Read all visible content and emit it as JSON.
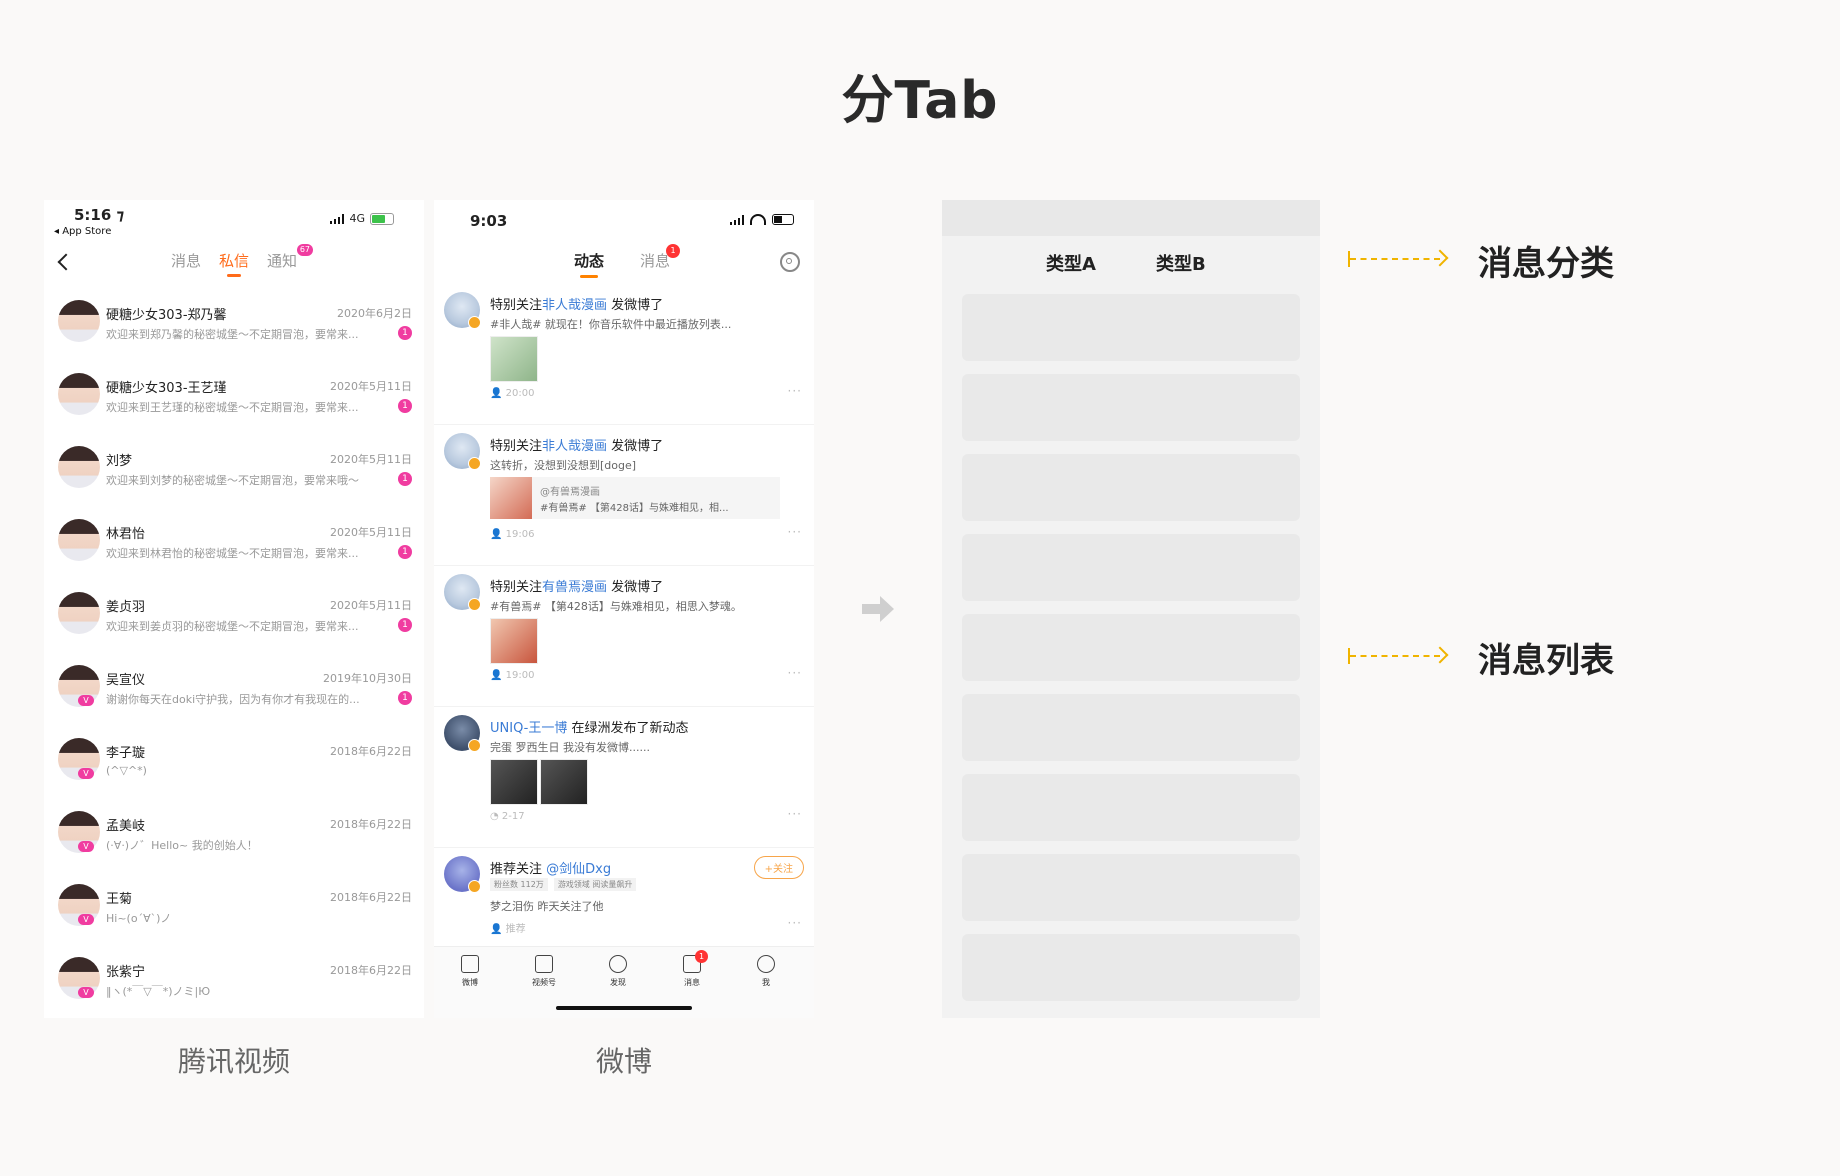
{
  "page": {
    "title": "分Tab"
  },
  "tencent": {
    "caption": "腾讯视频",
    "status": {
      "time": "5:16 ⁊",
      "back_app": "◂ App Store",
      "network": "4G"
    },
    "tabs": [
      {
        "label": "消息",
        "active": false
      },
      {
        "label": "私信",
        "active": true
      },
      {
        "label": "通知",
        "active": false,
        "badge": "67"
      }
    ],
    "items": [
      {
        "name": "硬糖少女303-郑乃馨",
        "date": "2020年6月2日",
        "msg": "欢迎来到郑乃馨的秘密城堡～不定期冒泡，要常来...",
        "unread": "1",
        "vip": false
      },
      {
        "name": "硬糖少女303-王艺瑾",
        "date": "2020年5月11日",
        "msg": "欢迎来到王艺瑾的秘密城堡～不定期冒泡，要常来...",
        "unread": "1",
        "vip": false
      },
      {
        "name": "刘梦",
        "date": "2020年5月11日",
        "msg": "欢迎来到刘梦的秘密城堡～不定期冒泡，要常来哦～",
        "unread": "1",
        "vip": false
      },
      {
        "name": "林君怡",
        "date": "2020年5月11日",
        "msg": "欢迎来到林君怡的秘密城堡～不定期冒泡，要常来...",
        "unread": "1",
        "vip": false
      },
      {
        "name": "姜贞羽",
        "date": "2020年5月11日",
        "msg": "欢迎来到姜贞羽的秘密城堡～不定期冒泡，要常来...",
        "unread": "1",
        "vip": false
      },
      {
        "name": "吴宣仪",
        "date": "2019年10月30日",
        "msg": "谢谢你每天在doki守护我，因为有你才有我现在的...",
        "unread": "1",
        "vip": true
      },
      {
        "name": "李子璇",
        "date": "2018年6月22日",
        "msg": "(^▽^*)",
        "unread": "",
        "vip": true
      },
      {
        "name": "孟美岐",
        "date": "2018年6月22日",
        "msg": "(·∀·)ノ゛Hello~ 我的创始人！",
        "unread": "",
        "vip": true
      },
      {
        "name": "王菊",
        "date": "2018年6月22日",
        "msg": "Hi~(o´∀`)ノ",
        "unread": "",
        "vip": true
      },
      {
        "name": "张紫宁",
        "date": "2018年6月22日",
        "msg": "‖ヽ(*￣▽￣*)ノミ|Ю",
        "unread": "",
        "vip": true
      }
    ]
  },
  "weibo": {
    "caption": "微博",
    "status": {
      "time": "9:03"
    },
    "tabs": [
      {
        "label": "动态",
        "active": true
      },
      {
        "label": "消息",
        "active": false,
        "badge": "1"
      }
    ],
    "posts": [
      {
        "head_pre": "特别关注",
        "head_link": "非人哉漫画",
        "head_post": " 发微博了",
        "text": "#非人哉# 就现在！你音乐软件中最近播放列表...",
        "meta": "👤 20:00"
      },
      {
        "head_pre": "特别关注",
        "head_link": "非人哉漫画",
        "head_post": " 发微博了",
        "text": "这转折，没想到没想到[doge]",
        "card_title": "@有兽焉漫画",
        "card_text": "#有兽焉# 【第428话】与姝难相见，相...",
        "meta": "👤 19:06"
      },
      {
        "head_pre": "特别关注",
        "head_link": "有兽焉漫画",
        "head_post": " 发微博了",
        "text": "#有兽焉# 【第428话】与姝难相见，相思入梦魂。",
        "meta": "👤 19:00"
      },
      {
        "head_pre": "",
        "head_link": "UNIQ-王一博",
        "head_post": " 在绿洲发布了新动态",
        "text": "完蛋 罗西生日 我没有发微博......",
        "meta": "◔ 2-17"
      },
      {
        "head_pre": "推荐关注 ",
        "head_link": "@剑仙Dxg",
        "head_post": "",
        "tags": [
          "粉丝数 112万",
          "游戏领域 阅读量飙升"
        ],
        "text": "梦之泪伤 昨天关注了他",
        "meta": "👤 推荐",
        "follow": "+关注"
      }
    ],
    "tabbar": [
      {
        "label": "微博"
      },
      {
        "label": "视频号"
      },
      {
        "label": "发现"
      },
      {
        "label": "消息",
        "badge": "1"
      },
      {
        "label": "我"
      }
    ]
  },
  "wireframe": {
    "tabs": [
      "类型A",
      "类型B"
    ],
    "card_count": 9
  },
  "annotations": {
    "top": "消息分类",
    "bottom": "消息列表",
    "color": "#f0b400"
  }
}
